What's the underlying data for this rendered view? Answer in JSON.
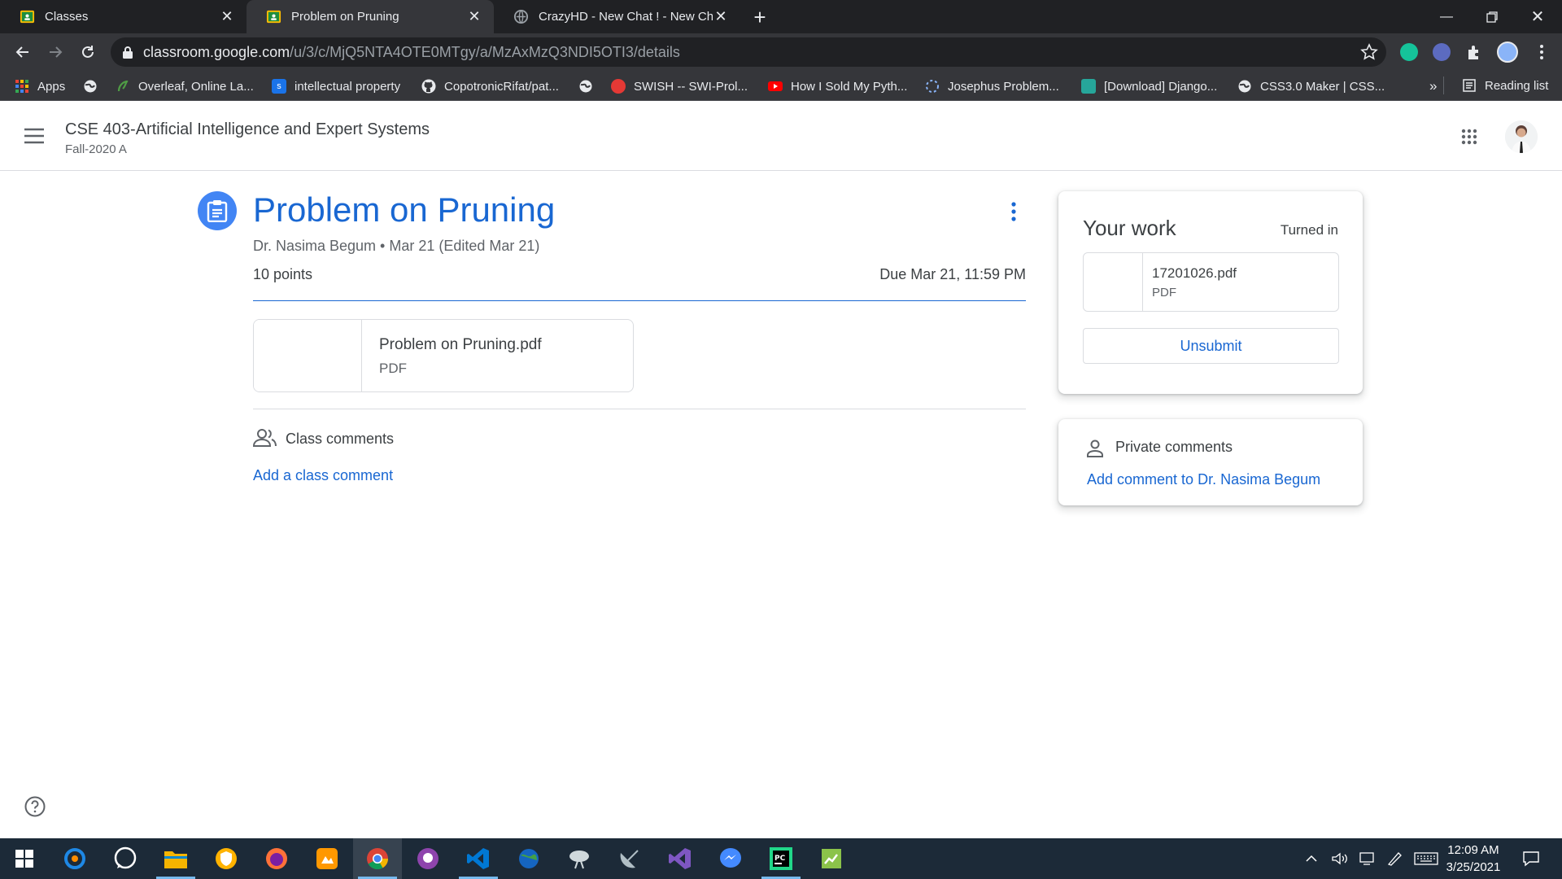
{
  "browser": {
    "tabs": [
      {
        "title": "Classes",
        "active": false
      },
      {
        "title": "Problem on Pruning",
        "active": true
      },
      {
        "title": "CrazyHD - New Chat ! - New Cha",
        "active": false
      }
    ],
    "url_host": "classroom.google.com",
    "url_path": "/u/3/c/MjQ5NTA4OTE0MTgy/a/MzAxMzQ3NDI5OTI3/details",
    "bookmarks": [
      {
        "label": "Apps",
        "icon": "apps-grid-icon",
        "color": "#ea4335"
      },
      {
        "label": "",
        "icon": "globe-icon",
        "color": "#9aa0a6"
      },
      {
        "label": "Overleaf, Online La...",
        "icon": "overleaf-icon",
        "color": "#4f9c45"
      },
      {
        "label": "intellectual property",
        "icon": "scribd-icon",
        "color": "#1a73e8"
      },
      {
        "label": "CopotronicRifat/pat...",
        "icon": "github-icon",
        "color": "#e8eaed"
      },
      {
        "label": "",
        "icon": "globe-icon",
        "color": "#9aa0a6"
      },
      {
        "label": "SWISH -- SWI-Prol...",
        "icon": "swish-icon",
        "color": "#e53935"
      },
      {
        "label": "How I Sold My Pyth...",
        "icon": "youtube-icon",
        "color": "#ff0000"
      },
      {
        "label": "Josephus Problem...",
        "icon": "loading-icon",
        "color": "#8ab4f8"
      },
      {
        "label": "[Download] Django...",
        "icon": "django-icon",
        "color": "#26a69a"
      },
      {
        "label": "CSS3.0 Maker | CSS...",
        "icon": "globe-icon",
        "color": "#9aa0a6"
      }
    ],
    "overflow_label": "»",
    "reading_list": "Reading list"
  },
  "course": {
    "title": "CSE 403-Artificial Intelligence and Expert Systems",
    "section": "Fall-2020 A"
  },
  "assignment": {
    "title": "Problem on Pruning",
    "meta": "Dr. Nasima Begum • Mar 21 (Edited Mar 21)",
    "points": "10 points",
    "due": "Due Mar 21, 11:59 PM",
    "attachment": {
      "name": "Problem on Pruning.pdf",
      "type": "PDF"
    },
    "class_comments_label": "Class comments",
    "add_class_comment": "Add a class comment"
  },
  "your_work": {
    "title": "Your work",
    "status": "Turned in",
    "file": {
      "name": "17201026.pdf",
      "type": "PDF"
    },
    "unsubmit_label": "Unsubmit"
  },
  "private_comments": {
    "label": "Private comments",
    "add_link": "Add comment to Dr. Nasima Begum"
  },
  "taskbar": {
    "apps": [
      {
        "name": "start-button",
        "color": "#ffffff"
      },
      {
        "name": "app-1",
        "color": "#1e88e5"
      },
      {
        "name": "whatsapp",
        "color": "#25d366"
      },
      {
        "name": "file-explorer",
        "color": "#f4b400"
      },
      {
        "name": "app-4",
        "color": "#ffb300"
      },
      {
        "name": "firefox",
        "color": "#ff7139"
      },
      {
        "name": "app-6",
        "color": "#ff9800"
      },
      {
        "name": "chrome",
        "color": "#4285f4"
      },
      {
        "name": "github-desktop",
        "color": "#8e44ad"
      },
      {
        "name": "vscode",
        "color": "#0078d4"
      },
      {
        "name": "app-10",
        "color": "#43a047"
      },
      {
        "name": "app-11",
        "color": "#cfd8dc"
      },
      {
        "name": "app-12",
        "color": "#b0bec5"
      },
      {
        "name": "visual-studio",
        "color": "#7e57c2"
      },
      {
        "name": "messenger",
        "color": "#448aff"
      },
      {
        "name": "pycharm",
        "color": "#21d789"
      },
      {
        "name": "app-16",
        "color": "#8bc34a"
      }
    ],
    "time": "12:09 AM",
    "date": "3/25/2021"
  }
}
